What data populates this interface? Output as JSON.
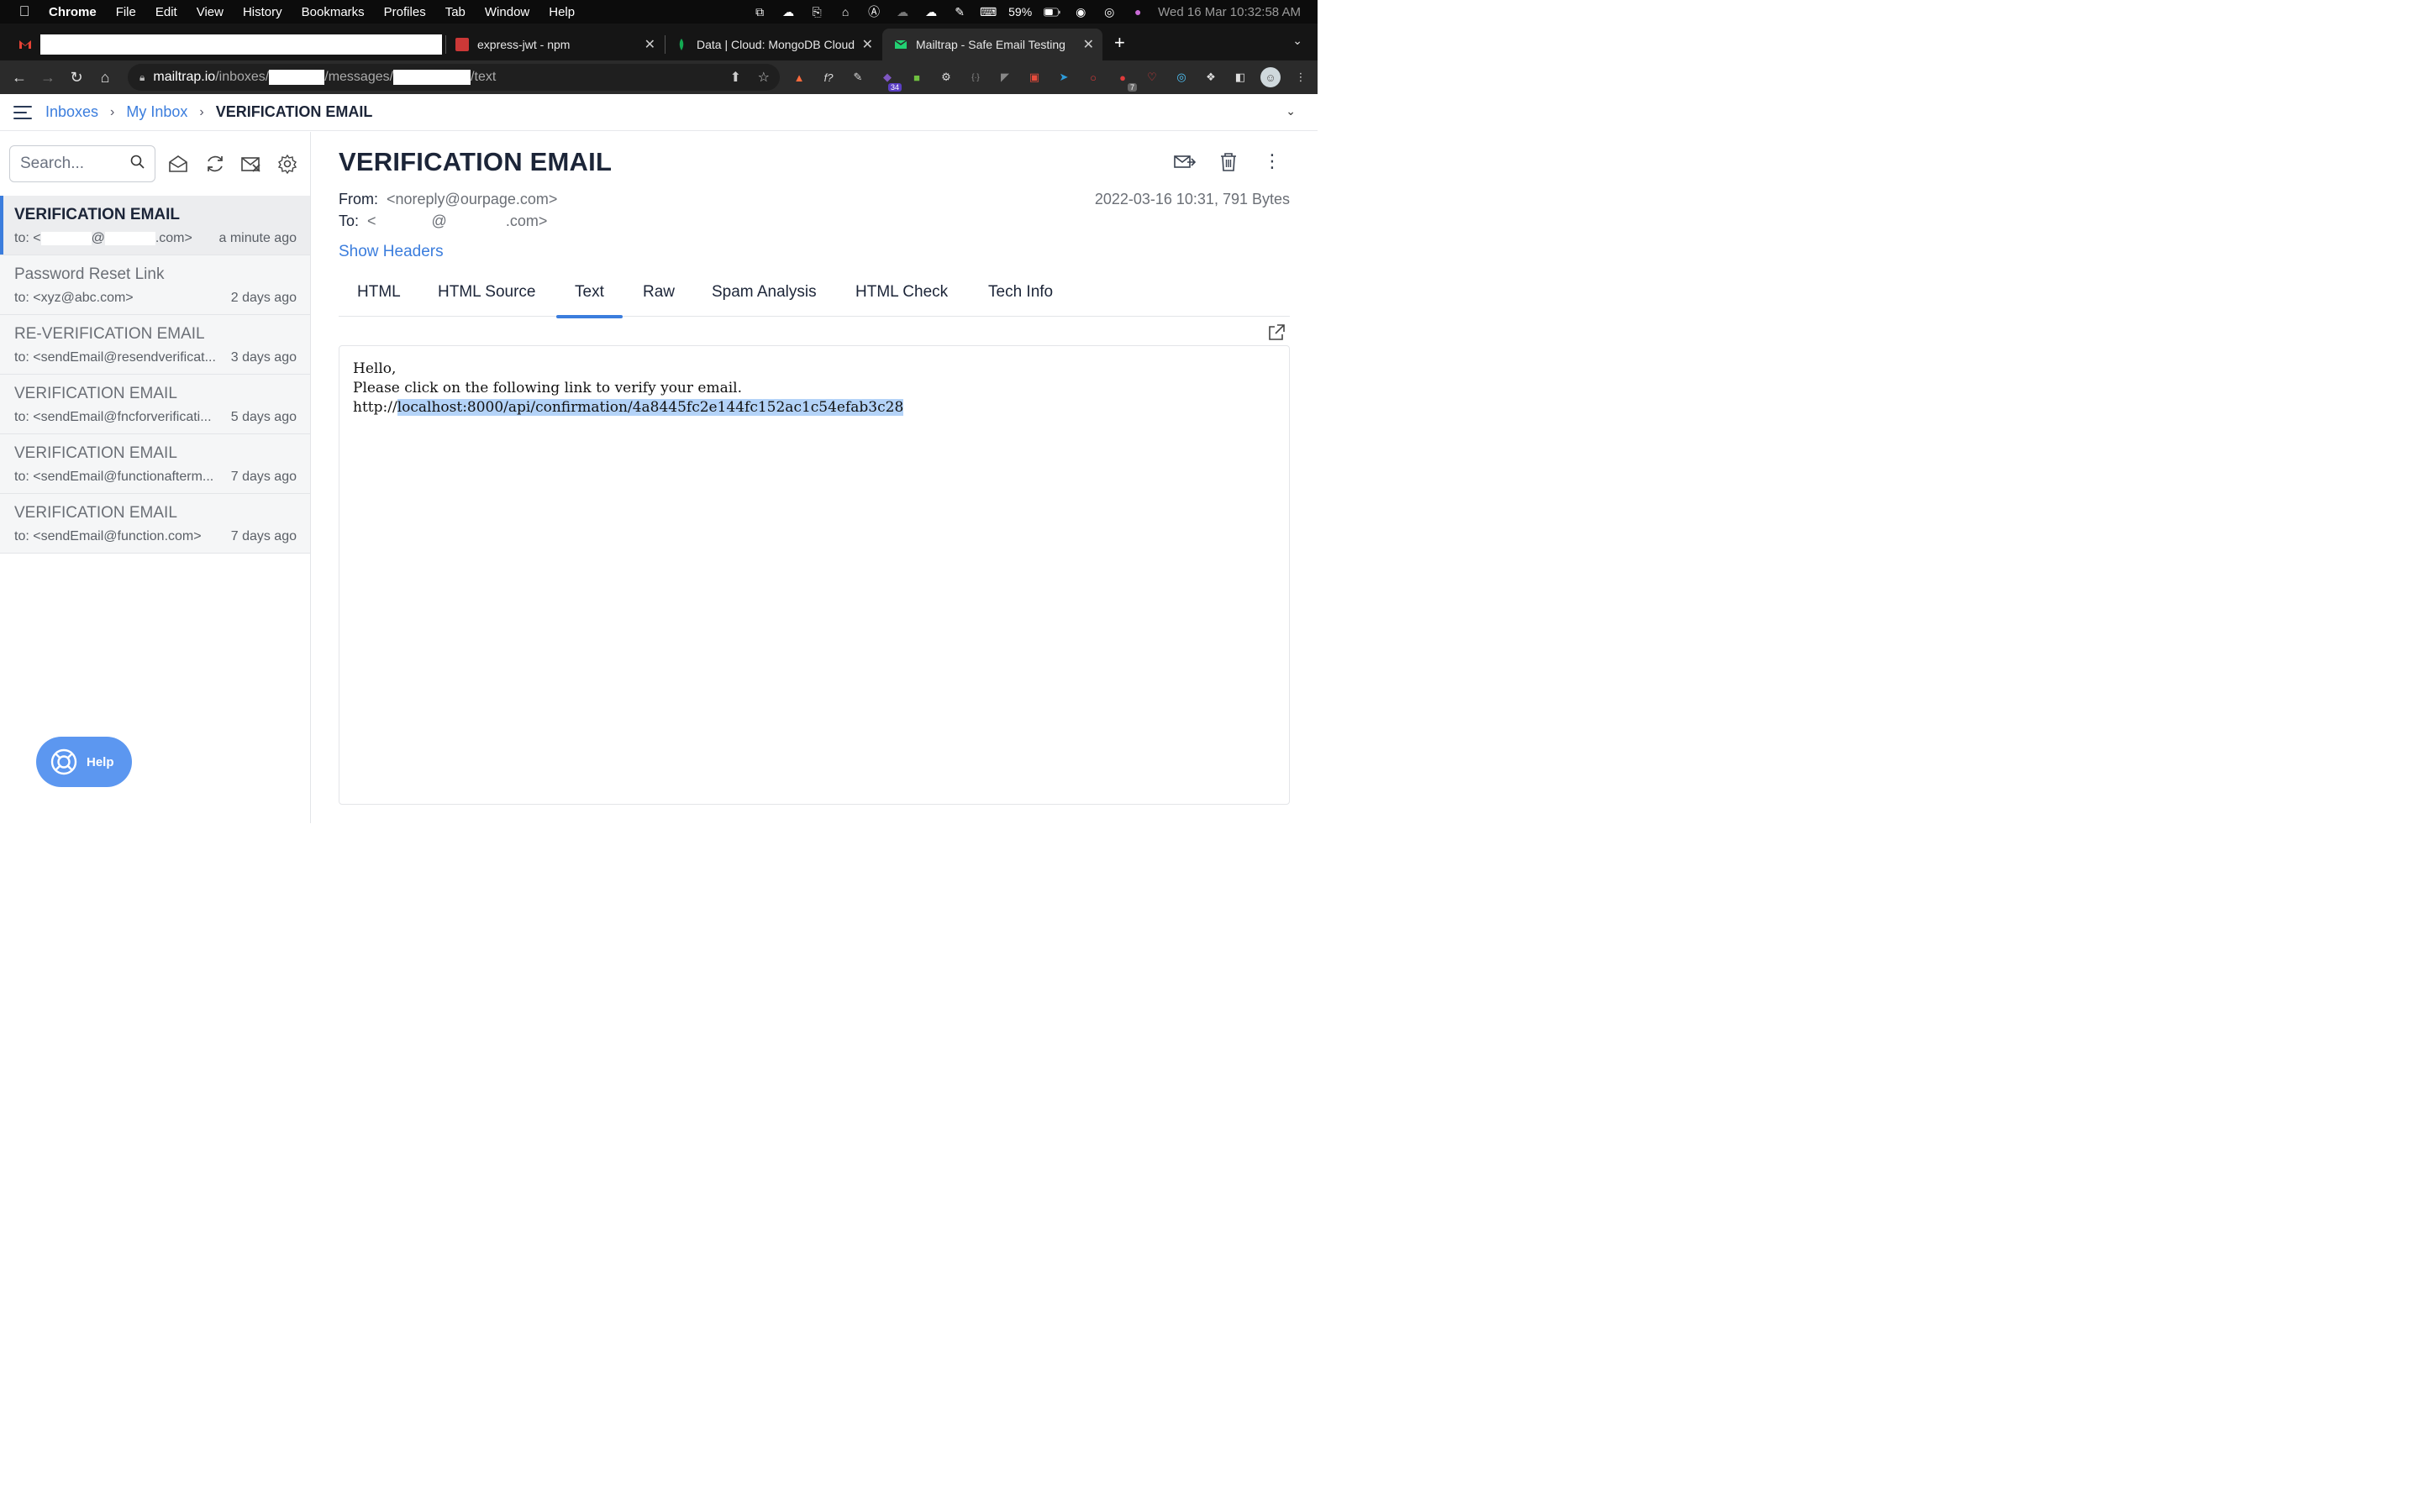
{
  "menubar": {
    "app": "Chrome",
    "items": [
      "File",
      "Edit",
      "View",
      "History",
      "Bookmarks",
      "Profiles",
      "Tab",
      "Window",
      "Help"
    ],
    "battery": "59%",
    "clock": "Wed 16 Mar  10:32:58 AM"
  },
  "tabs": [
    {
      "title": "",
      "favicon": "gmail-icon"
    },
    {
      "title": "express-jwt - npm",
      "favicon": "npm-icon"
    },
    {
      "title": "Data | Cloud: MongoDB Cloud",
      "favicon": "mongodb-icon"
    },
    {
      "title": "Mailtrap - Safe Email Testing",
      "favicon": "mailtrap-icon",
      "active": true
    }
  ],
  "address": {
    "host": "mailtrap.io",
    "seg1": "/inboxes/",
    "seg2": "/messages/",
    "seg3": "/text"
  },
  "extensions": {
    "badge1": "34",
    "badge2": "7"
  },
  "breadcrumb": {
    "inboxes": "Inboxes",
    "my_inbox": "My Inbox",
    "current": "VERIFICATION EMAIL"
  },
  "sidebar": {
    "search_placeholder": "Search...",
    "messages": [
      {
        "subject": "VERIFICATION EMAIL",
        "to_prefix": "to: <",
        "to_at": "@",
        "to_suffix": ".com>",
        "age": "a minute ago",
        "active": true
      },
      {
        "subject": "Password Reset Link",
        "to": "to: <xyz@abc.com>",
        "age": "2 days ago"
      },
      {
        "subject": "RE-VERIFICATION EMAIL",
        "to": "to: <sendEmail@resendverificat...",
        "age": "3 days ago"
      },
      {
        "subject": "VERIFICATION EMAIL",
        "to": "to: <sendEmail@fncforverificati...",
        "age": "5 days ago"
      },
      {
        "subject": "VERIFICATION EMAIL",
        "to": "to: <sendEmail@functionafterm...",
        "age": "7 days ago"
      },
      {
        "subject": "VERIFICATION EMAIL",
        "to": "to: <sendEmail@function.com>",
        "age": "7 days ago"
      }
    ],
    "help": "Help"
  },
  "message": {
    "title": "VERIFICATION EMAIL",
    "from_label": "From:",
    "from_value": "<noreply@ourpage.com>",
    "to_label": "To:",
    "to_prefix": "<",
    "to_at": "@",
    "to_suffix": ".com>",
    "date_size": "2022-03-16 10:31, 791 Bytes",
    "show_headers": "Show Headers",
    "view_tabs": [
      "HTML",
      "HTML Source",
      "Text",
      "Raw",
      "Spam Analysis",
      "HTML Check",
      "Tech Info"
    ],
    "active_tab": "Text",
    "body_line1": "Hello,",
    "body_line2": "Please click on the following link to verify your email.",
    "body_link_prefix": "http://",
    "body_link_selected": "localhost:8000/api/confirmation/4a8445fc2e144fc152ac1c54efab3c28"
  }
}
